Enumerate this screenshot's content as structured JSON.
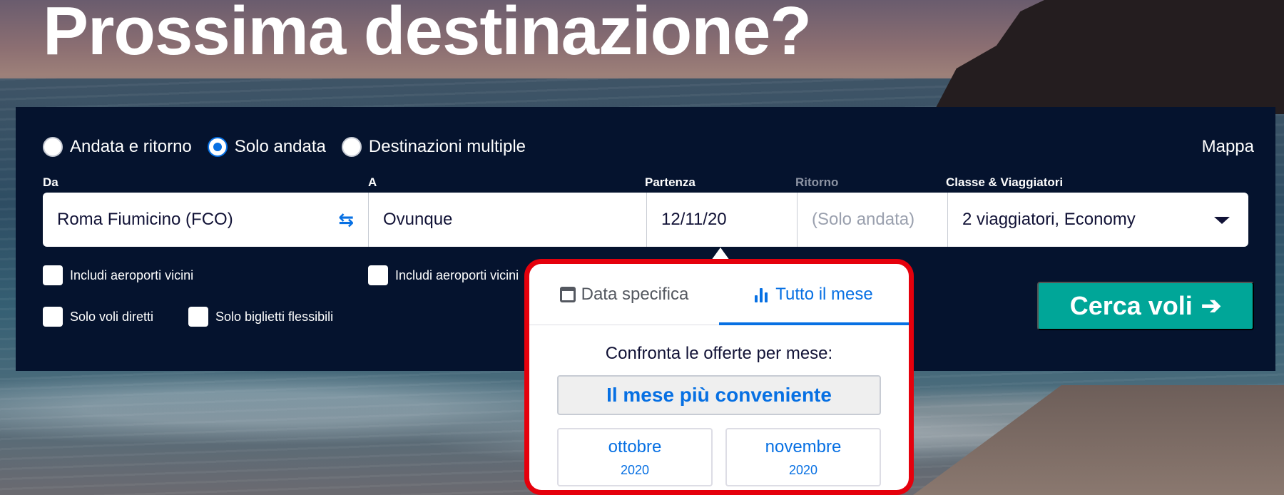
{
  "hero": {
    "title": "Prossima destinazione?"
  },
  "trip_types": [
    {
      "label": "Andata e ritorno",
      "selected": false
    },
    {
      "label": "Solo andata",
      "selected": true
    },
    {
      "label": "Destinazioni multiple",
      "selected": false
    }
  ],
  "map_link": "Mappa",
  "labels": {
    "from": "Da",
    "to": "A",
    "departure": "Partenza",
    "return": "Ritorno",
    "class": "Classe & Viaggiatori"
  },
  "fields": {
    "from": "Roma Fiumicino (FCO)",
    "to": "Ovunque",
    "departure": "12/11/20",
    "return": "(Solo andata)",
    "class": "2 viaggiatori, Economy"
  },
  "options": {
    "nearby_from": "Includi aeroporti vicini",
    "nearby_to": "Includi aeroporti vicini",
    "direct": "Solo voli diretti",
    "flexible": "Solo biglietti flessibili"
  },
  "search_button": "Cerca voli",
  "search_arrow": "➔",
  "date_popover": {
    "tabs": [
      {
        "label": "Data specifica",
        "active": false
      },
      {
        "label": "Tutto il mese",
        "active": true
      }
    ],
    "prompt": "Confronta le offerte per mese:",
    "cheapest_label": "Il mese più conveniente",
    "months": [
      {
        "name": "ottobre",
        "year": "2020"
      },
      {
        "name": "novembre",
        "year": "2020"
      }
    ],
    "highlight_color": "#e5000c"
  },
  "colors": {
    "accent": "#0770e3",
    "cta": "#00a698",
    "panel": "#05132e"
  },
  "icons": {
    "swap": "swap-arrows-icon",
    "dropdown": "caret-down-icon",
    "calendar": "calendar-icon",
    "bars": "bar-chart-icon"
  }
}
